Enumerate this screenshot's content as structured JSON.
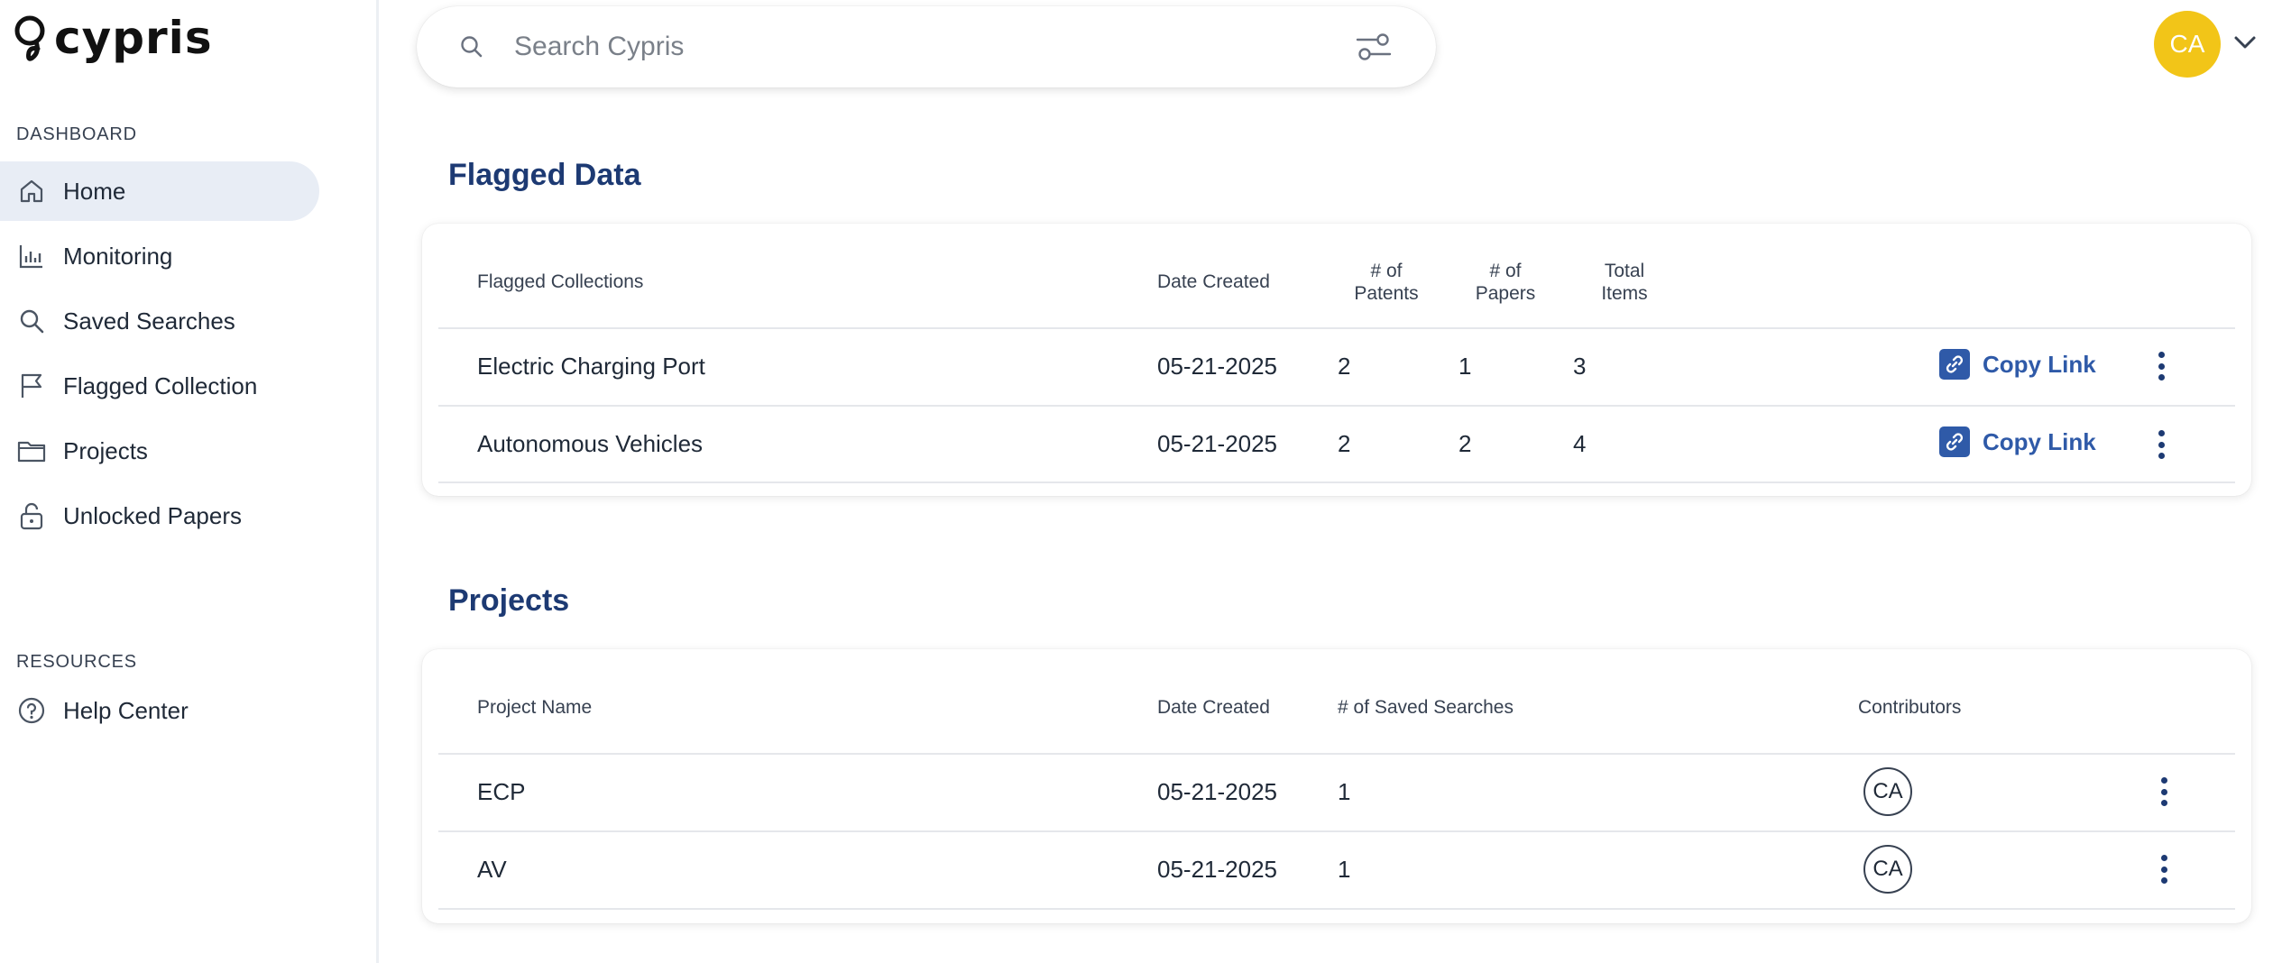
{
  "app": {
    "name": "cypris",
    "user_initials": "CA"
  },
  "colors": {
    "accent": "#1d3a73",
    "link": "#2f5aa8",
    "avatar": "#f2c518",
    "active_nav": "#e8edf5"
  },
  "sidebar": {
    "dashboard_label": "DASHBOARD",
    "items": [
      {
        "label": "Home",
        "icon": "home-icon",
        "active": true
      },
      {
        "label": "Monitoring",
        "icon": "bar-chart-icon"
      },
      {
        "label": "Saved Searches",
        "icon": "search-icon"
      },
      {
        "label": "Flagged Collection",
        "icon": "flag-icon"
      },
      {
        "label": "Projects",
        "icon": "folder-icon"
      },
      {
        "label": "Unlocked Papers",
        "icon": "unlock-icon"
      }
    ],
    "resources_label": "RESOURCES",
    "resources": [
      {
        "label": "Help Center",
        "icon": "help-circle-icon"
      }
    ]
  },
  "search": {
    "placeholder": "Search Cypris",
    "value": ""
  },
  "flagged": {
    "title": "Flagged Data",
    "columns": {
      "name": "Flagged Collections",
      "date": "Date Created",
      "patents_line1": "# of",
      "patents_line2": "Patents",
      "papers_line1": "# of",
      "papers_line2": "Papers",
      "total_line1": "Total",
      "total_line2": "Items"
    },
    "copy_link_label": "Copy Link",
    "rows": [
      {
        "name": "Electric Charging Port",
        "date": "05-21-2025",
        "patents": "2",
        "papers": "1",
        "total": "3"
      },
      {
        "name": "Autonomous Vehicles",
        "date": "05-21-2025",
        "patents": "2",
        "papers": "2",
        "total": "4"
      }
    ]
  },
  "projects": {
    "title": "Projects",
    "columns": {
      "name": "Project Name",
      "date": "Date Created",
      "saved": "# of Saved Searches",
      "contributors": "Contributors"
    },
    "rows": [
      {
        "name": "ECP",
        "date": "05-21-2025",
        "saved": "1",
        "contributor": "CA"
      },
      {
        "name": "AV",
        "date": "05-21-2025",
        "saved": "1",
        "contributor": "CA"
      }
    ]
  }
}
